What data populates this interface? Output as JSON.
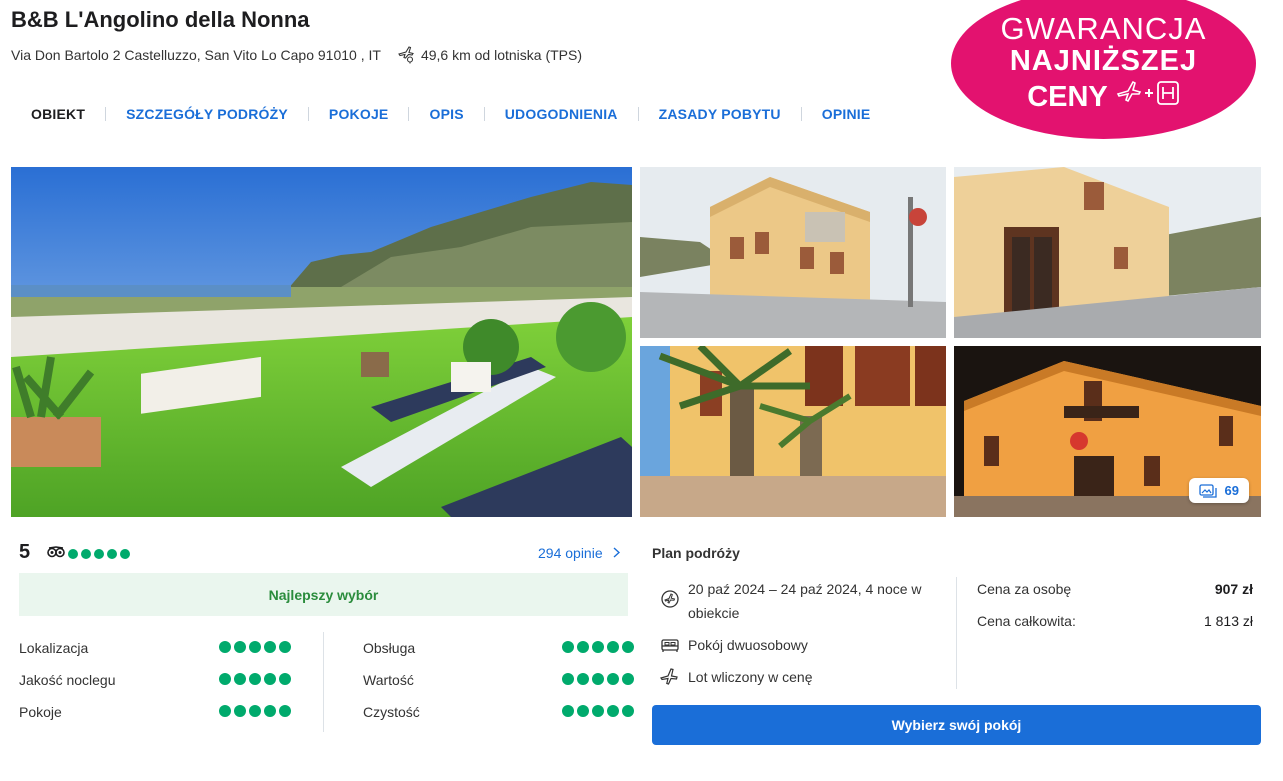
{
  "hotel": {
    "name": "B&B L'Angolino della Nonna",
    "address": "Via Don Bartolo 2 Castelluzzo, San Vito Lo Capo 91010 , IT",
    "airport_distance": "49,6 km od lotniska (TPS)"
  },
  "nav": {
    "items": [
      {
        "label": "OBIEKT",
        "active": true
      },
      {
        "label": "SZCZEGÓŁY PODRÓŻY"
      },
      {
        "label": "POKOJE"
      },
      {
        "label": "OPIS"
      },
      {
        "label": "UDOGODNIENIA"
      },
      {
        "label": "ZASADY POBYTU"
      },
      {
        "label": "OPINIE"
      }
    ]
  },
  "badge": {
    "line1": "GWARANCJA",
    "line2": "NAJNIŻSZEJ",
    "line3": "CENY",
    "color": "#e3126f"
  },
  "gallery": {
    "count": "69"
  },
  "reviews": {
    "score": "5",
    "tripadvisor_rating": 5,
    "count_link": "294 opinie",
    "best_choice": "Najlepszy wybór",
    "categories_left": [
      {
        "label": "Lokalizacja",
        "rating": 5
      },
      {
        "label": "Jakość noclegu",
        "rating": 5
      },
      {
        "label": "Pokoje",
        "rating": 5
      }
    ],
    "categories_right": [
      {
        "label": "Obsługa",
        "rating": 5
      },
      {
        "label": "Wartość",
        "rating": 5
      },
      {
        "label": "Czystość",
        "rating": 5
      }
    ]
  },
  "plan": {
    "title": "Plan podróży",
    "dates": "20 paź 2024 – 24 paź 2024, 4 noce w obiekcie",
    "room": "Pokój dwuosobowy",
    "flight": "Lot wliczony w cenę"
  },
  "price": {
    "per_person_label": "Cena za osobę",
    "per_person_value": "907 zł",
    "total_label": "Cena całkowita:",
    "total_value": "1 813 zł"
  },
  "cta": {
    "label": "Wybierz swój pokój",
    "color": "#1a6ed8"
  },
  "colors": {
    "accent": "#1a6ed8",
    "tripadvisor": "#00aa6c",
    "best_bg": "#eaf6ee",
    "best_text": "#2a8c3c"
  }
}
